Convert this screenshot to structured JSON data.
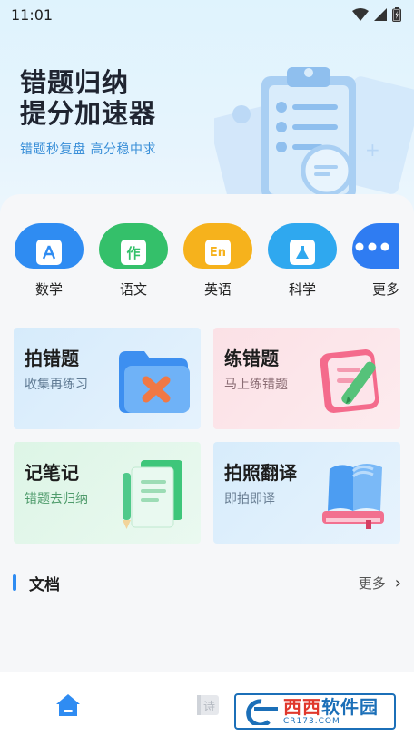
{
  "status_bar": {
    "time": "11:01"
  },
  "hero": {
    "title_line1": "错题归纳",
    "title_line2": "提分加速器",
    "subtitle": "错题秒复盘  高分稳中求"
  },
  "subjects": [
    {
      "label": "数学",
      "icon": "A",
      "color": "#2f8cf2"
    },
    {
      "label": "语文",
      "icon": "作",
      "color": "#34c06a"
    },
    {
      "label": "英语",
      "icon": "En",
      "color": "#f6b21c"
    },
    {
      "label": "科学",
      "icon": "flask",
      "color": "#2fa8ef"
    },
    {
      "label": "更多",
      "icon": "dots",
      "color": "#2f7cf2"
    }
  ],
  "cards": [
    {
      "title": "拍错题",
      "desc": "收集再练习"
    },
    {
      "title": "练错题",
      "desc": "马上练错题"
    },
    {
      "title": "记笔记",
      "desc": "错题去归纳"
    },
    {
      "title": "拍照翻译",
      "desc": "即拍即译"
    }
  ],
  "docs": {
    "title": "文档",
    "more": "更多",
    "chevron": "›"
  },
  "tabbar": {
    "poem_char": "诗"
  },
  "watermark": {
    "main_a": "西西",
    "main_b": "软件园",
    "url": "CR173.COM"
  }
}
